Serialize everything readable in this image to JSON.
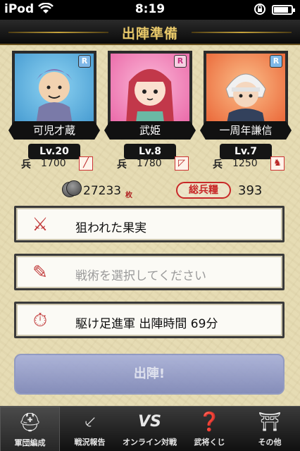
{
  "status": {
    "carrier": "iPod",
    "time": "8:19",
    "battery_level": 0.85
  },
  "title": "出陣準備",
  "generals": [
    {
      "name": "可児才蔵",
      "level": "Lv.20",
      "troops": "1700",
      "rarity": "R",
      "color": "#3c93cc"
    },
    {
      "name": "武姫",
      "level": "Lv.8",
      "troops": "1780",
      "rarity": "R",
      "color": "#e85da1"
    },
    {
      "name": "一周年謙信",
      "level": "Lv.7",
      "troops": "1250",
      "rarity": "R",
      "color": "#e85a2c"
    }
  ],
  "troop_glyph": "兵",
  "resources": {
    "coins": "27233",
    "coin_unit": "枚",
    "rice_label": "総兵糧",
    "rice": "393"
  },
  "options": [
    {
      "icon": "crossed-swords-icon",
      "label": "狙われた果実",
      "placeholder": false
    },
    {
      "icon": "scroll-icon",
      "label": "戦術を選択してください",
      "placeholder": true
    },
    {
      "icon": "stopwatch-icon",
      "label": "駆け足進軍 出陣時間 69分",
      "placeholder": false
    }
  ],
  "sortie_label": "出陣!",
  "tabs": [
    {
      "icon": "helmet-icon",
      "label": "軍団編成",
      "active": true
    },
    {
      "icon": "spear-icon",
      "label": "戦況報告",
      "active": false
    },
    {
      "icon": "vs-icon",
      "label": "オンライン対戦",
      "active": false
    },
    {
      "icon": "question-icon",
      "label": "武将くじ",
      "active": false
    },
    {
      "icon": "gate-icon",
      "label": "その他",
      "active": false
    }
  ]
}
